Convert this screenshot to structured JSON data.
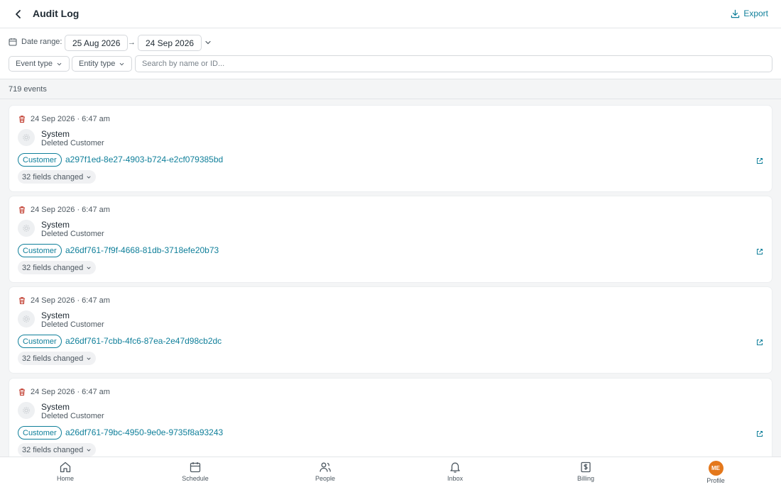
{
  "header": {
    "title": "Audit Log",
    "export_label": "Export"
  },
  "filters": {
    "date_range_label": "Date range:",
    "date_from": "25 Aug 2026",
    "date_to": "24 Sep 2026",
    "arrow": "→",
    "event_type_label": "Event type",
    "entity_type_label": "Entity type",
    "search_placeholder": "Search by name or ID..."
  },
  "count_label": "719 events",
  "events": [
    {
      "timestamp": "24 Sep 2026 · 6:47 am",
      "actor": "System",
      "action": "Deleted Customer",
      "entity_type": "Customer",
      "entity_id": "a297f1ed-8e27-4903-b724-e2cf079385bd",
      "fields_changed": "32 fields changed"
    },
    {
      "timestamp": "24 Sep 2026 · 6:47 am",
      "actor": "System",
      "action": "Deleted Customer",
      "entity_type": "Customer",
      "entity_id": "a26df761-7f9f-4668-81db-3718efe20b73",
      "fields_changed": "32 fields changed"
    },
    {
      "timestamp": "24 Sep 2026 · 6:47 am",
      "actor": "System",
      "action": "Deleted Customer",
      "entity_type": "Customer",
      "entity_id": "a26df761-7cbb-4fc6-87ea-2e47d98cb2dc",
      "fields_changed": "32 fields changed"
    },
    {
      "timestamp": "24 Sep 2026 · 6:47 am",
      "actor": "System",
      "action": "Deleted Customer",
      "entity_type": "Customer",
      "entity_id": "a26df761-79bc-4950-9e0e-9735f8a93243",
      "fields_changed": "32 fields changed"
    }
  ],
  "nav": {
    "home": "Home",
    "schedule": "Schedule",
    "people": "People",
    "inbox": "Inbox",
    "billing": "Billing",
    "profile": "Profile",
    "profile_initials": "ME"
  },
  "colors": {
    "accent": "#0f7f9a",
    "delete_icon": "#c0392b",
    "avatar": "#e4781c"
  }
}
